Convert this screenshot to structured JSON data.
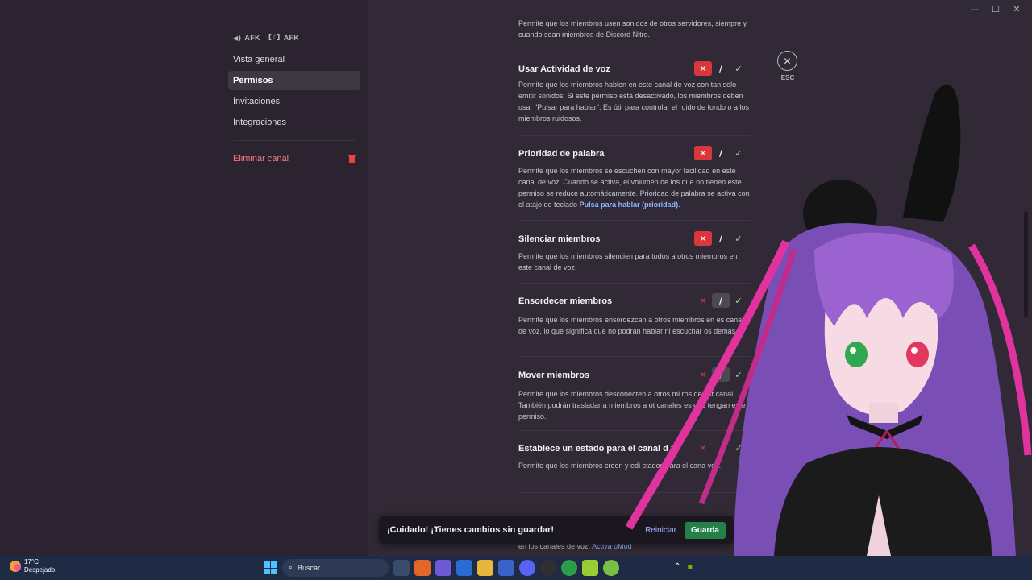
{
  "window_controls": [
    "—",
    "☐",
    "✕"
  ],
  "sidebar": {
    "header": "AFK",
    "header_suffix": "AFK",
    "items": [
      {
        "label": "Vista general"
      },
      {
        "label": "Permisos"
      },
      {
        "label": "Invitaciones"
      },
      {
        "label": "Integraciones"
      }
    ],
    "delete_label": "Eliminar canal"
  },
  "top_desc": "Permite que los miembros usen sonidos de otros servidores, siempre y cuando sean miembros de Discord Nitro.",
  "permissions": [
    {
      "title": "Usar Actividad de voz",
      "desc": "Permite que los miembros hablen en este canal de voz con tan solo emitir sonidos. Si este permiso está desactivado, los miembros deben usar \"Pulsar para hablar\". Es útil para controlar el ruido de fondo o a los miembros ruidosos.",
      "state": "deny"
    },
    {
      "title": "Prioridad de palabra",
      "desc_before": "Permite que los miembros se escuchen con mayor facilidad en este canal de voz. Cuando se activa, el volumen de los que no tienen este permiso se reduce automáticamente. Prioridad de palabra se activa con el atajo de teclado ",
      "desc_link": "Pulsa para hablar (prioridad)",
      "desc_after": ".",
      "state": "deny"
    },
    {
      "title": "Silenciar miembros",
      "desc": "Permite que los miembros silencien para todos a otros miembros en este canal de voz.",
      "state": "deny"
    },
    {
      "title": "Ensordecer miembros",
      "desc": "Permite que los miembros ensordezcan a otros miembros en es canal de voz, lo que significa que no podrán hablar ni escuchar os demás.",
      "state": "neutral"
    },
    {
      "title": "Mover miembros",
      "desc": "Permite que los miembros desconecten a otros mi ros de est canal. También podrán trasladar a miembros a ot canales es que tengan este permiso.",
      "state": "neutral"
    },
    {
      "title": "Establece un estado para el canal d z",
      "desc": "Permite que los miembros creen y edi stados para el cana voz.",
      "state": "deny-partial"
    }
  ],
  "toggle_glyphs": {
    "deny": "✕",
    "neutral": "/",
    "allow": "✓"
  },
  "esc": {
    "icon": "✕",
    "label": "ESC"
  },
  "savebar": {
    "message": "¡Cuidado! ¡Tienes cambios sin guardar!",
    "reset": "Reiniciar",
    "save": "Guarda"
  },
  "peek": {
    "text": "en los canales de voz. ",
    "link": "Activa oMod"
  },
  "taskbar": {
    "temp": "17°C",
    "weather": "Despejado",
    "search_placeholder": "Buscar",
    "search_icon": "search-icon"
  },
  "colors": {
    "deny": "#da373c",
    "save": "#248046",
    "link": "#8fb5ff",
    "danger": "#f47b80"
  }
}
